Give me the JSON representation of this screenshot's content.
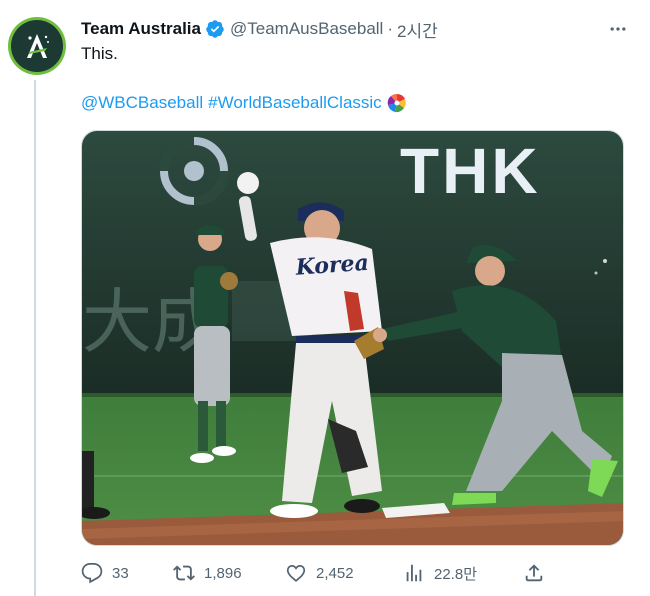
{
  "tweet": {
    "display_name": "Team Australia",
    "handle": "@TeamAusBaseball",
    "separator": "·",
    "time": "2시간",
    "text": "This.",
    "hashtags": [
      "@WBCBaseball",
      "#WorldBaseballClassic"
    ],
    "media": {
      "sign_text": "THK",
      "banner_text": "大成",
      "jersey_text": "Korea"
    }
  },
  "actions": {
    "replies": "33",
    "retweets": "1,896",
    "likes": "2,452",
    "views": "22.8만"
  },
  "colors": {
    "accent": "#1d9bf0",
    "text": "#0f1419",
    "muted": "#536471",
    "avatar_ring": "#6fbf3c",
    "avatar_bg": "#1c3a33"
  }
}
